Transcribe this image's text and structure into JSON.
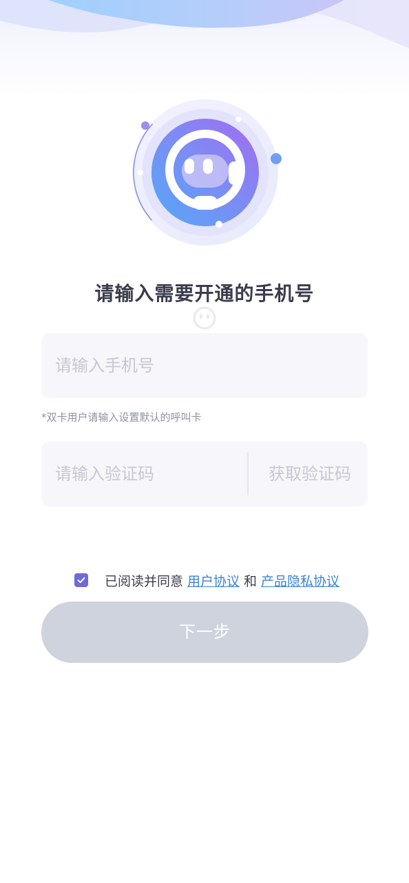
{
  "heading": "请输入需要开通的手机号",
  "phone": {
    "placeholder": "请输入手机号",
    "value": ""
  },
  "hint": "*双卡用户请输入设置默认的呼叫卡",
  "code": {
    "placeholder": "请输入验证码",
    "value": "",
    "get_code_label": "获取验证码"
  },
  "agreement": {
    "checked": true,
    "prefix": "已阅读并同意",
    "user_agreement": "用户协议",
    "connector": "和",
    "privacy_agreement": "产品隐私协议"
  },
  "next_button": "下一步",
  "colors": {
    "accent": "#6f6ad7",
    "link": "#3b82d9",
    "button_disabled": "#ced3de",
    "input_bg": "#f6f6fb"
  },
  "icons": [
    "headset-chat-logo",
    "smile-watermark-icon",
    "checkmark-icon"
  ]
}
